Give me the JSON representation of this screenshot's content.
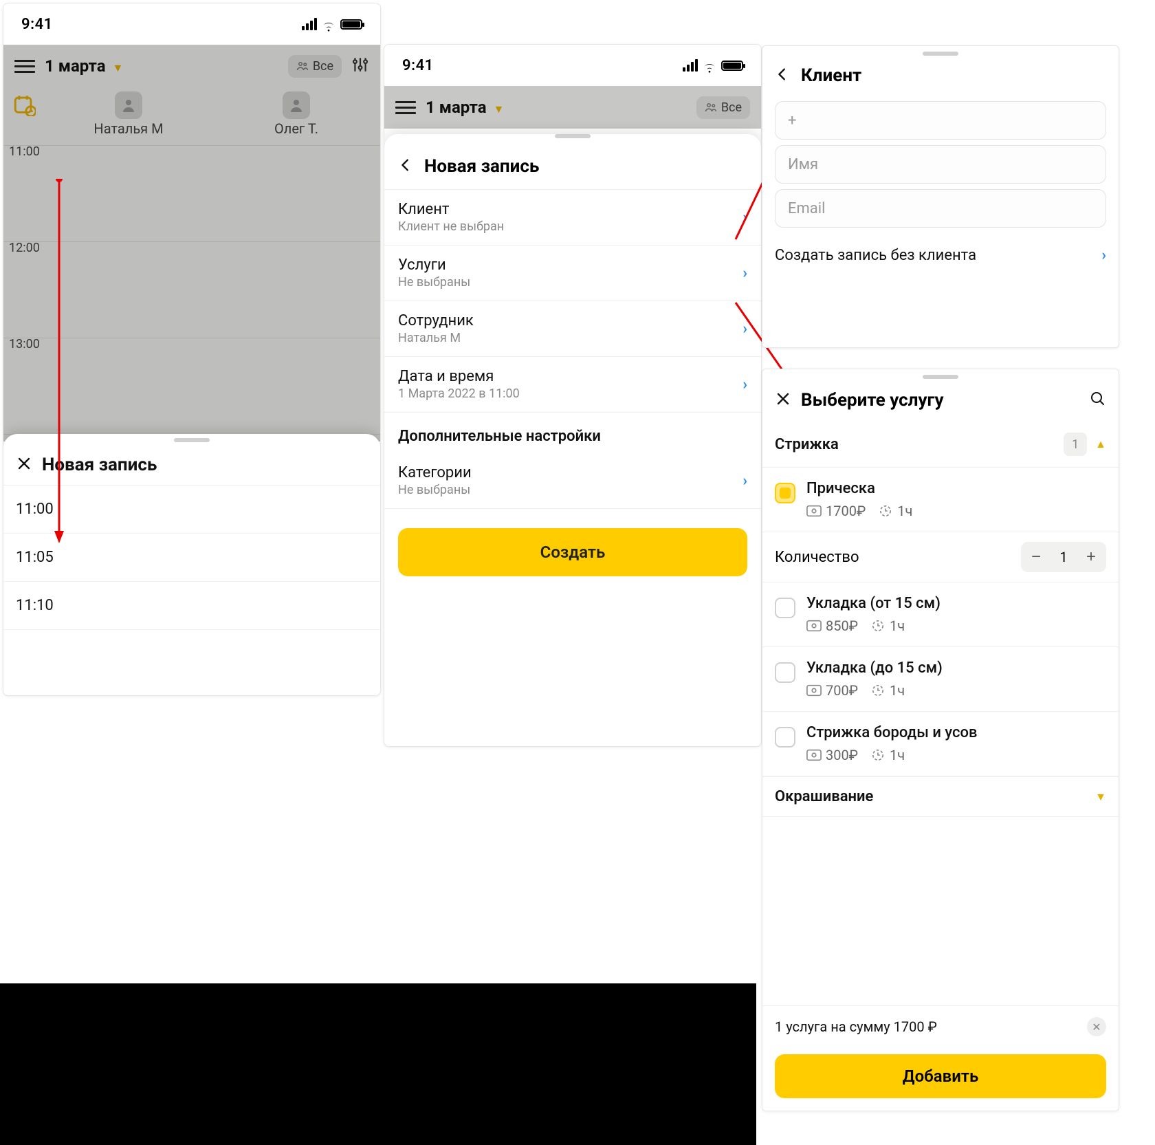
{
  "status": {
    "time": "9:41"
  },
  "screen1": {
    "date": "1 марта",
    "all_filter": "Все",
    "staff": [
      "Наталья М",
      "Олег Т."
    ],
    "hours": [
      "11:00",
      "12:00",
      "13:00"
    ],
    "sheet_title": "Новая запись",
    "time_options": [
      "11:00",
      "11:05",
      "11:10"
    ]
  },
  "screen2": {
    "date": "1 марта",
    "all_filter": "Все",
    "sheet_title": "Новая запись",
    "rows": {
      "client": {
        "label": "Клиент",
        "sub": "Клиент не выбран"
      },
      "services": {
        "label": "Услуги",
        "sub": "Не выбраны"
      },
      "staff": {
        "label": "Сотрудник",
        "sub": "Наталья М"
      },
      "datetime": {
        "label": "Дата и время",
        "sub": "1 Марта 2022 в 11:00"
      },
      "categories": {
        "label": "Категории",
        "sub": "Не выбраны"
      }
    },
    "extra_section": "Дополнительные настройки",
    "create_btn": "Создать"
  },
  "panel3": {
    "title": "Клиент",
    "phone_placeholder": "+",
    "name_placeholder": "Имя",
    "email_placeholder": "Email",
    "skip_client": "Создать запись без клиента"
  },
  "panel4": {
    "title": "Выберите услугу",
    "category1": {
      "name": "Стрижка",
      "count": "1"
    },
    "services": [
      {
        "name": "Прическа",
        "price": "1700₽",
        "dur": "1ч",
        "checked": true
      },
      {
        "name": "Укладка (от 15 см)",
        "price": "850₽",
        "dur": "1ч",
        "checked": false
      },
      {
        "name": "Укладка (до 15 см)",
        "price": "700₽",
        "dur": "1ч",
        "checked": false
      },
      {
        "name": "Стрижка бороды и усов",
        "price": "300₽",
        "dur": "1ч",
        "checked": false
      }
    ],
    "qty_label": "Количество",
    "qty_value": "1",
    "category2": "Окрашивание",
    "summary": "1 услуга на сумму 1700 ₽",
    "add_btn": "Добавить"
  }
}
